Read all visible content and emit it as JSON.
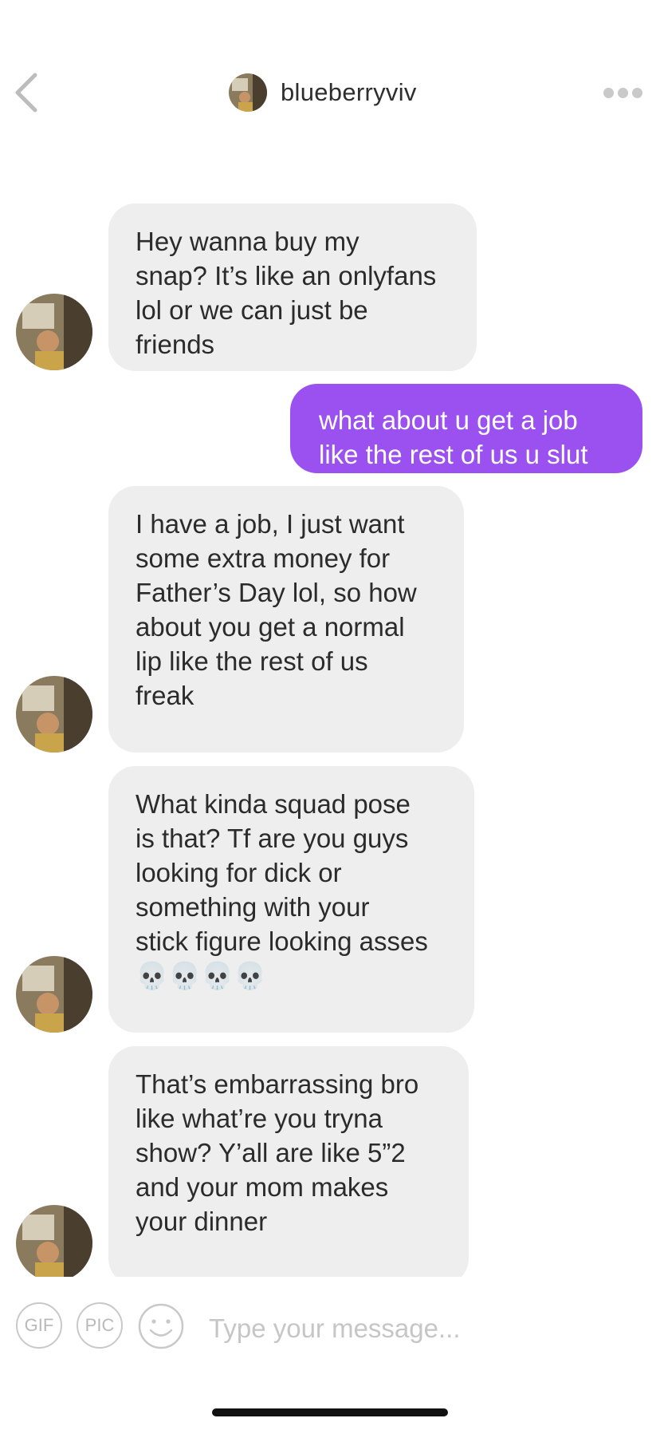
{
  "header": {
    "back_icon": "chevron-left-icon",
    "username": "blueberryviv",
    "more_icon": "ellipsis-icon"
  },
  "messages": [
    {
      "direction": "incoming",
      "text": "Hey wanna buy my\nsnap? It’s like an onlyfans\nlol or we can just be\nfriends"
    },
    {
      "direction": "outgoing",
      "text": "what about u get a job\nlike the rest of us u slut"
    },
    {
      "direction": "incoming",
      "text": "I have a job, I just want\nsome extra money for\nFather’s Day lol, so how\nabout you get a normal\nlip like the rest of us\nfreak"
    },
    {
      "direction": "incoming",
      "text": "What kinda squad pose\nis that? Tf are you guys\nlooking for dick or\nsomething with your\nstick figure looking asses\n💀💀💀💀"
    },
    {
      "direction": "incoming",
      "text": "That’s embarrassing bro\nlike what’re you tryna\nshow? Y’all are like 5”2\nand your mom makes\nyour dinner"
    }
  ],
  "composer": {
    "gif_label": "GIF",
    "pic_label": "PIC",
    "emoji_icon": "smiley-icon",
    "placeholder": "Type your message..."
  },
  "colors": {
    "outgoing_bubble": "#9b51f0",
    "incoming_bubble": "#eeeeee",
    "icon_gray": "#c9c9c9"
  }
}
